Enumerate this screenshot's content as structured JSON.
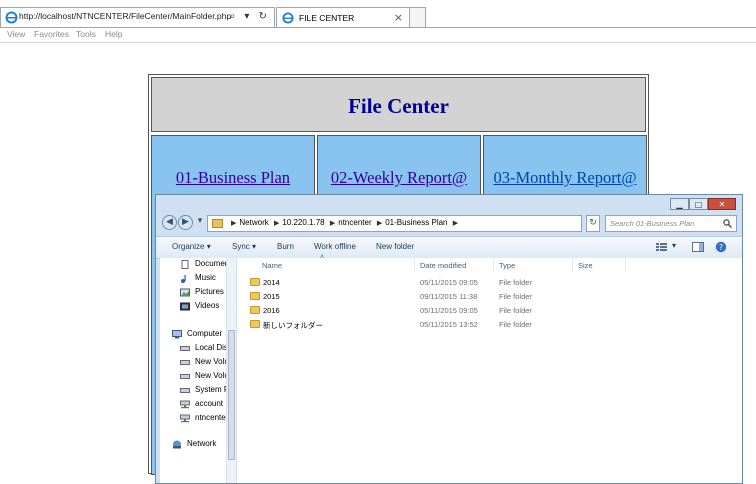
{
  "browser": {
    "address": "http://localhost/NTNCENTER/FileCenter/MainFolder.php",
    "tab_title": "FILE CENTER",
    "menu": [
      "View",
      "Favorites",
      "Tools",
      "Help"
    ]
  },
  "page": {
    "title": "File Center",
    "links": [
      {
        "label": "01-Business Plan",
        "color": "#330099"
      },
      {
        "label": "02-Weekly Report@",
        "color": "#330099"
      },
      {
        "label": "03-Monthly Report@",
        "color": "#0044aa"
      }
    ]
  },
  "explorer": {
    "breadcrumb": [
      "Network",
      "10.220.1.78",
      "ntncenter",
      "01-Business Plan"
    ],
    "search_placeholder": "Search 01-Business Plan",
    "toolbar": [
      "Organize",
      "Sync",
      "Burn",
      "Work offline",
      "New folder"
    ],
    "nav_items": [
      {
        "label": "Documents",
        "icon": "documents-icon"
      },
      {
        "label": "Music",
        "icon": "music-icon"
      },
      {
        "label": "Pictures",
        "icon": "pictures-icon"
      },
      {
        "label": "Videos",
        "icon": "videos-icon"
      },
      {
        "label": "Computer",
        "icon": "computer-icon"
      },
      {
        "label": "Local Disk",
        "icon": "drive-icon"
      },
      {
        "label": "New Volume",
        "icon": "drive-icon"
      },
      {
        "label": "New Volume",
        "icon": "drive-icon"
      },
      {
        "label": "System Reserved",
        "icon": "drive-icon"
      },
      {
        "label": "account",
        "icon": "network-drive-icon"
      },
      {
        "label": "ntncenter",
        "icon": "network-drive-icon"
      },
      {
        "label": "Network",
        "icon": "network-icon"
      }
    ],
    "columns": [
      "Name",
      "Date modified",
      "Type",
      "Size"
    ],
    "files": [
      {
        "name": "2014",
        "date": "05/11/2015 09:05",
        "type": "File folder"
      },
      {
        "name": "2015",
        "date": "09/11/2015 11:38",
        "type": "File folder"
      },
      {
        "name": "2016",
        "date": "05/11/2015 09:05",
        "type": "File folder"
      },
      {
        "name": "新しいフォルダー",
        "date": "05/11/2015 13:52",
        "type": "File folder"
      }
    ]
  }
}
